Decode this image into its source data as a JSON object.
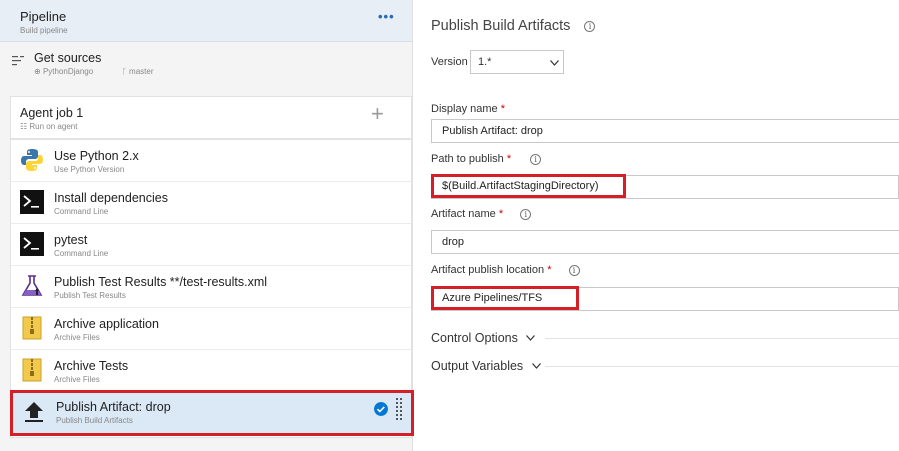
{
  "pipeline": {
    "title": "Pipeline",
    "subtitle": "Build pipeline",
    "more": "•••"
  },
  "sources": {
    "title": "Get sources",
    "repo": "PythonDjango",
    "branch": "master"
  },
  "agent_job": {
    "title": "Agent job 1",
    "subtitle": "Run on agent",
    "add": "+"
  },
  "tasks": [
    {
      "title": "Use Python 2.x",
      "subtitle": "Use Python Version",
      "icon": "python-icon"
    },
    {
      "title": "Install dependencies",
      "subtitle": "Command Line",
      "icon": "terminal-icon"
    },
    {
      "title": "pytest",
      "subtitle": "Command Line",
      "icon": "terminal-icon"
    },
    {
      "title": "Publish Test Results **/test-results.xml",
      "subtitle": "Publish Test Results",
      "icon": "flask-icon"
    },
    {
      "title": "Archive application",
      "subtitle": "Archive Files",
      "icon": "zip-icon"
    },
    {
      "title": "Archive Tests",
      "subtitle": "Archive Files",
      "icon": "zip-icon"
    },
    {
      "title": "Publish Artifact: drop",
      "subtitle": "Publish Build Artifacts",
      "icon": "upload-icon"
    }
  ],
  "panel": {
    "title": "Publish Build Artifacts",
    "version_label": "Version",
    "version_value": "1.*",
    "display_name_label": "Display name",
    "display_name_value": "Publish Artifact: drop",
    "path_label": "Path to publish",
    "path_value": "$(Build.ArtifactStagingDirectory)",
    "artifact_name_label": "Artifact name",
    "artifact_name_value": "drop",
    "location_label": "Artifact publish location",
    "location_value": "Azure Pipelines/TFS",
    "required_mark": "*",
    "info_glyph": "i",
    "control_options": "Control Options",
    "output_variables": "Output Variables"
  },
  "colors": {
    "accent": "#0078d4",
    "highlight": "#d51f26",
    "selected_bg": "#dbe8f6",
    "header_bg": "#e7eef6"
  }
}
